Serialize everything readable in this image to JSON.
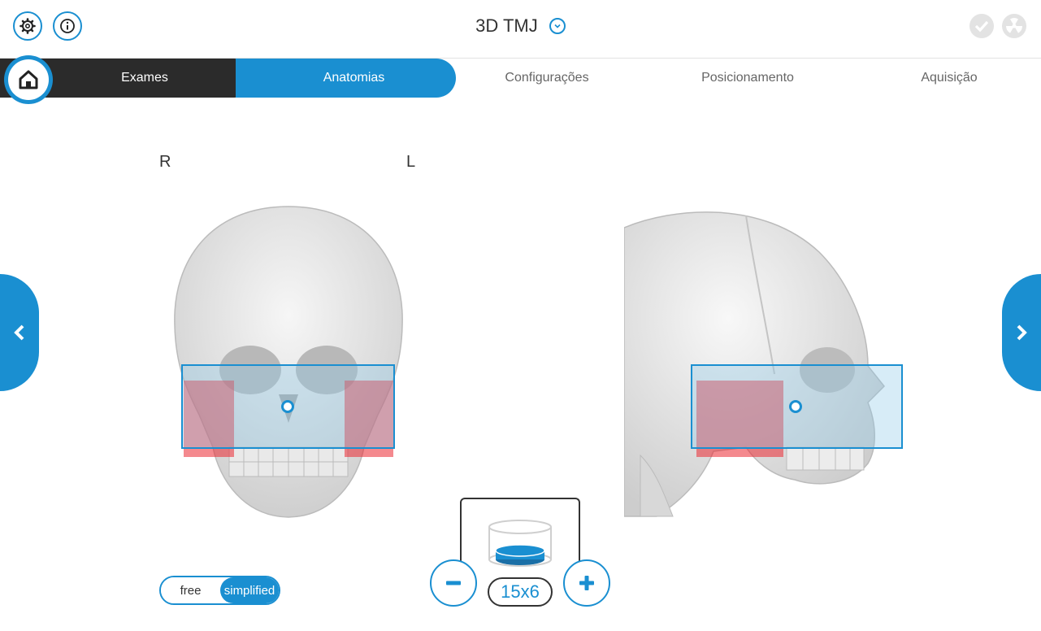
{
  "header": {
    "title": "3D TMJ",
    "icons": [
      "gear-icon",
      "info-icon",
      "chevron-down-icon",
      "check-icon",
      "radiation-icon"
    ]
  },
  "tabs": [
    {
      "label": "Exames",
      "state": "done"
    },
    {
      "label": "Anatomias",
      "state": "active"
    },
    {
      "label": "Configurações",
      "state": "inactive"
    },
    {
      "label": "Posicionamento",
      "state": "inactive"
    },
    {
      "label": "Aquisição",
      "state": "inactive"
    }
  ],
  "views": {
    "front_left_label": "R",
    "front_right_label": "L"
  },
  "mode_toggle": {
    "options": [
      "free",
      "simplified"
    ],
    "selected": "simplified"
  },
  "fov": {
    "value": "15x6"
  },
  "colors": {
    "accent": "#1a8fd1",
    "dark_tab": "#2b2b2b",
    "highlight_red": "#eb2832"
  }
}
